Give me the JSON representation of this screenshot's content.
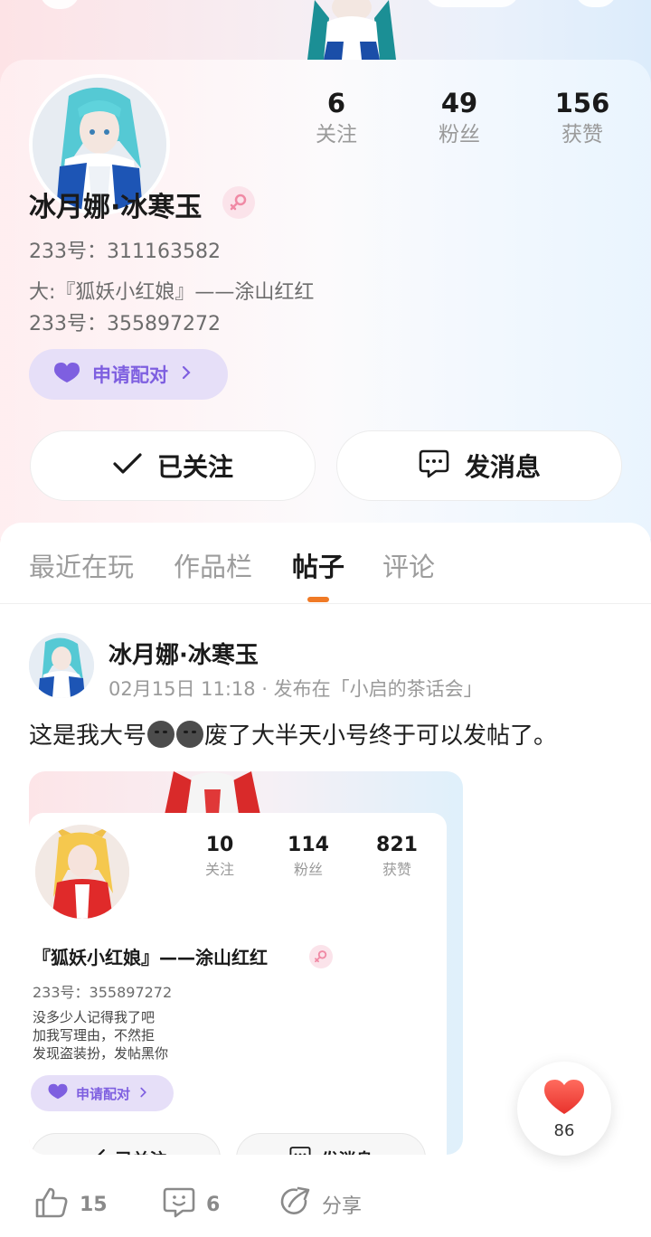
{
  "profile": {
    "username": "冰月娜·冰寒玉",
    "id_line": "233号：311163582",
    "bio_line1": "大:『狐妖小红娘』——涂山红红",
    "bio_line2": "233号：355897272",
    "pair_label": "申请配对",
    "follow_label": "已关注",
    "message_label": "发消息",
    "gender": "female"
  },
  "stats": {
    "following_num": "6",
    "following_label": "关注",
    "fans_num": "49",
    "fans_label": "粉丝",
    "likes_num": "156",
    "likes_label": "获赞"
  },
  "tabs": [
    "最近在玩",
    "作品栏",
    "帖子",
    "评论"
  ],
  "active_tab": "帖子",
  "post": {
    "author": "冰月娜·冰寒玉",
    "meta": "02月15日 11:18 · 发布在「小启的茶话会」",
    "text_before": "这是我大号",
    "text_after": "废了大半天小号终于可以发帖了。",
    "like_count": "15",
    "comment_count": "6",
    "share_label": "分享"
  },
  "embedded": {
    "stats": {
      "following_num": "10",
      "following_label": "关注",
      "fans_num": "114",
      "fans_label": "粉丝",
      "likes_num": "821",
      "likes_label": "获赞"
    },
    "username": "『狐妖小红娘』——涂山红红",
    "id_line": "233号：355897272",
    "bio1": "没多少人记得我了吧",
    "bio2": "加我写理由，不然拒",
    "bio3": "发现盗装扮，发帖黑你",
    "pair_label": "申请配对",
    "follow_label": "已关注",
    "message_label": "发消息"
  },
  "float_like": {
    "count": "86"
  },
  "colors": {
    "accent_orange": "#f07a26",
    "purple": "#7e5fe0",
    "heart_red": "#f2463f"
  }
}
